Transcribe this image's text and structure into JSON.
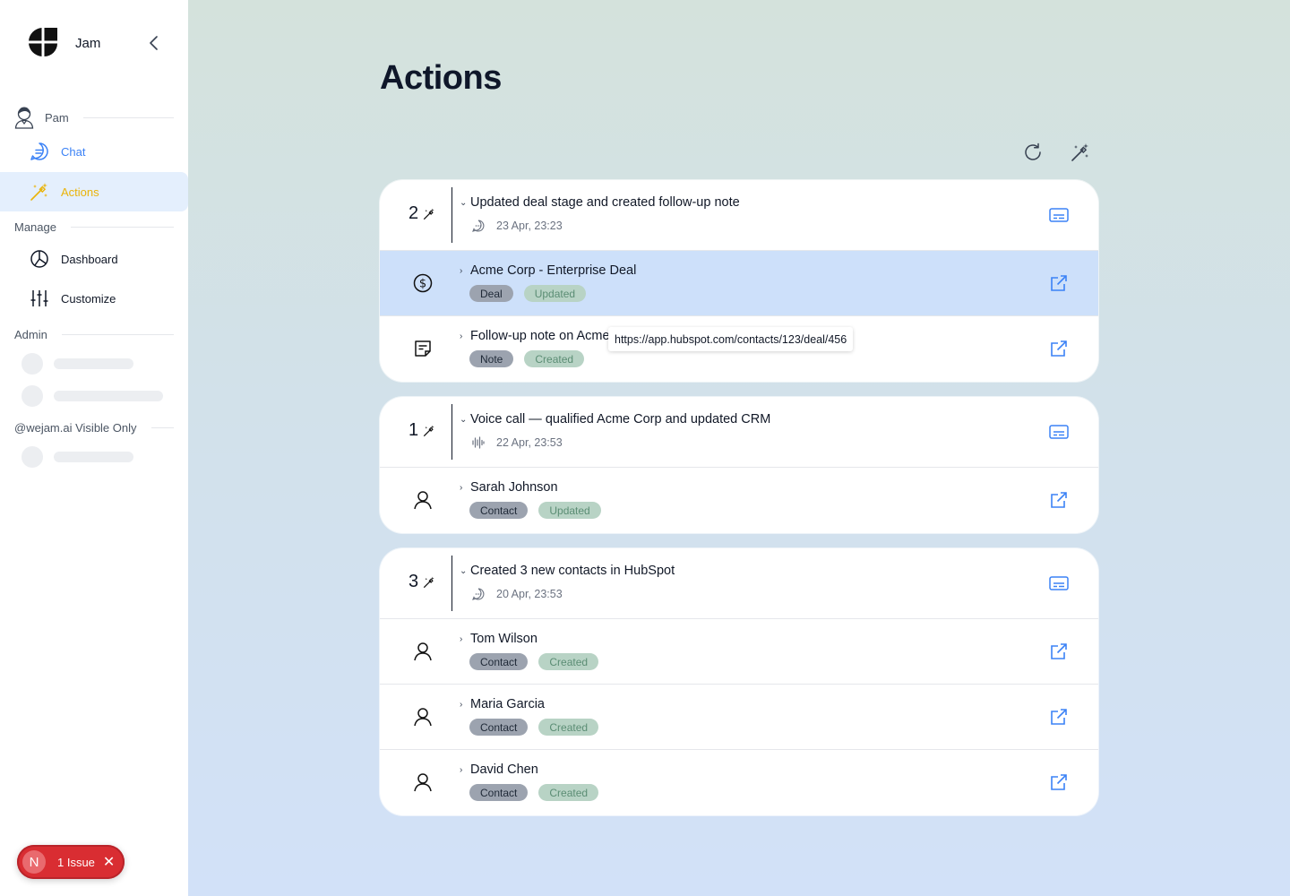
{
  "app": {
    "name": "Jam"
  },
  "sidebar": {
    "user": {
      "name": "Pam"
    },
    "nav": [
      {
        "label": "Chat"
      },
      {
        "label": "Actions"
      }
    ],
    "manage": {
      "heading": "Manage",
      "items": [
        {
          "label": "Dashboard"
        },
        {
          "label": "Customize"
        }
      ]
    },
    "admin": {
      "heading": "Admin"
    },
    "visible_only": {
      "heading": "@wejam.ai Visible Only"
    }
  },
  "issue_badge": {
    "letter": "N",
    "label": "1 Issue"
  },
  "page": {
    "title": "Actions"
  },
  "groups": [
    {
      "count": "2",
      "title": "Updated deal stage and created follow-up note",
      "meta_icon": "chat-bubble-icon",
      "time": "23 Apr, 23:23",
      "items": [
        {
          "icon": "dollar-circle-icon",
          "title": "Acme Corp - Enterprise Deal",
          "kind": "Deal",
          "status": "Updated",
          "highlighted": true
        },
        {
          "icon": "note-icon",
          "title": "Follow-up note on Acme",
          "kind": "Note",
          "status": "Created"
        }
      ]
    },
    {
      "count": "1",
      "title": "Voice call — qualified Acme Corp and updated CRM",
      "meta_icon": "audio-wave-icon",
      "time": "22 Apr, 23:53",
      "items": [
        {
          "icon": "person-icon",
          "title": "Sarah Johnson",
          "kind": "Contact",
          "status": "Updated"
        }
      ]
    },
    {
      "count": "3",
      "title": "Created 3 new contacts in HubSpot",
      "meta_icon": "chat-bubble-icon",
      "time": "20 Apr, 23:53",
      "items": [
        {
          "icon": "person-icon",
          "title": "Tom Wilson",
          "kind": "Contact",
          "status": "Created"
        },
        {
          "icon": "person-icon",
          "title": "Maria Garcia",
          "kind": "Contact",
          "status": "Created"
        },
        {
          "icon": "person-icon",
          "title": "David Chen",
          "kind": "Contact",
          "status": "Created"
        }
      ]
    }
  ],
  "tooltip": {
    "text": "https://app.hubspot.com/contacts/123/deal/456"
  },
  "colors": {
    "accent_blue": "#3b82f6",
    "actions_yellow": "#eab308",
    "active_nav_bg": "#e4effd",
    "highlight_row": "#cde0fa",
    "issue_red": "#d92d32"
  }
}
